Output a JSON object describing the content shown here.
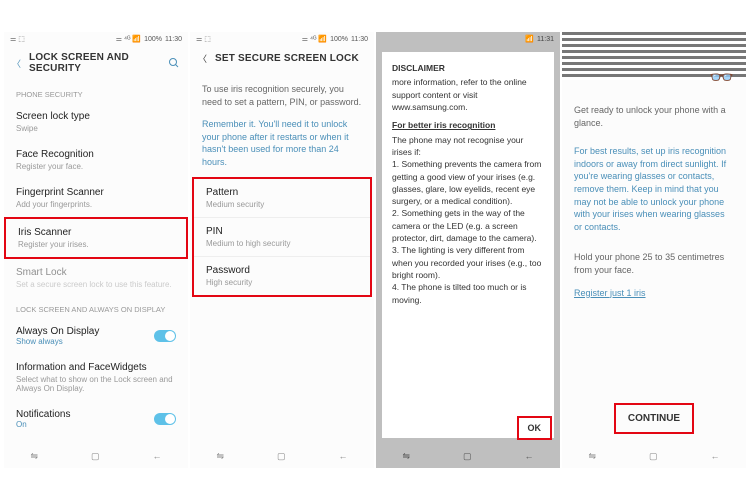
{
  "status": {
    "time": "11:30",
    "battery": "100%",
    "icons": "⚌ ⁴ᴳ 📶"
  },
  "nav": {
    "recent": "⇋",
    "home": "▢",
    "back": "←"
  },
  "s1": {
    "title": "LOCK SCREEN AND SECURITY",
    "sec_phone": "PHONE SECURITY",
    "sec_lock": "LOCK SCREEN AND ALWAYS ON DISPLAY",
    "items": {
      "screenlock": {
        "t": "Screen lock type",
        "s": "Swipe"
      },
      "face": {
        "t": "Face Recognition",
        "s": "Register your face."
      },
      "fp": {
        "t": "Fingerprint Scanner",
        "s": "Add your fingerprints."
      },
      "iris": {
        "t": "Iris Scanner",
        "s": "Register your irises."
      },
      "smart": {
        "t": "Smart Lock",
        "s": "Set a secure screen lock to use this feature."
      },
      "aod": {
        "t": "Always On Display",
        "s": "Show always"
      },
      "info": {
        "t": "Information and FaceWidgets",
        "s": "Select what to show on the Lock screen and Always On Display."
      },
      "notif": {
        "t": "Notifications",
        "s": "On"
      }
    }
  },
  "s2": {
    "title": "SET SECURE SCREEN LOCK",
    "body": "To use iris recognition securely, you need to set a pattern, PIN, or password.",
    "hint": "Remember it. You'll need it to unlock your phone after it restarts or when it hasn't been used for more than 24 hours.",
    "pattern": {
      "t": "Pattern",
      "s": "Medium security"
    },
    "pin": {
      "t": "PIN",
      "s": "Medium to high security"
    },
    "password": {
      "t": "Password",
      "s": "High security"
    }
  },
  "s3": {
    "heading": "DISCLAIMER",
    "intro": "more information, refer to the online support content or visit www.samsung.com.",
    "sub": "For better iris recognition",
    "lead": "The phone may not recognise your irises if:",
    "p1": "1. Something prevents the camera from getting a good view of your irises (e.g. glasses, glare, low eyelids, recent eye surgery, or a medical condition).",
    "p2": "2. Something gets in the way of the camera or the LED (e.g. a screen protector, dirt, damage to the camera).",
    "p3": "3. The lighting is very different from when you recorded your irises (e.g., too bright room).",
    "p4": "4. The phone is tilted too much or is moving.",
    "ok": "OK"
  },
  "s4": {
    "body1": "Get ready to unlock your phone with a glance.",
    "tips": "For best results, set up iris recognition indoors or away from direct sunlight. If you're wearing glasses or contacts, remove them. Keep in mind that you may not be able to unlock your phone with your irises when wearing glasses or contacts.",
    "body2": "Hold your phone 25 to 35 centimetres from your face.",
    "link": "Register just 1 iris",
    "continue": "CONTINUE"
  }
}
